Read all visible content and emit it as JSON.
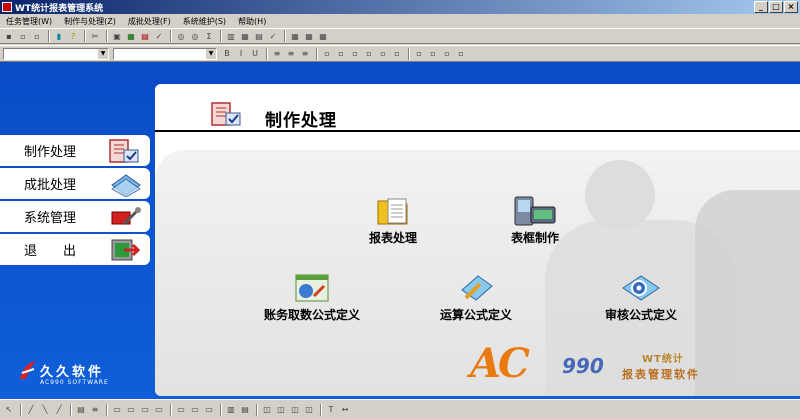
{
  "window": {
    "title": "WT统计报表管理系统"
  },
  "menu": [
    {
      "label": "任务管理(W)"
    },
    {
      "label": "制作与处理(Z)"
    },
    {
      "label": "成批处理(F)"
    },
    {
      "label": "系统维护(S)"
    },
    {
      "label": "帮助(H)"
    }
  ],
  "page": {
    "title": "制作处理"
  },
  "sidebar": [
    {
      "label": "制作处理",
      "icon": "report-edit-icon"
    },
    {
      "label": "成批处理",
      "icon": "batch-icon"
    },
    {
      "label": "系统管理",
      "icon": "system-tools-icon"
    },
    {
      "label": "退　　出",
      "icon": "exit-icon"
    }
  ],
  "features": {
    "report_process": "报表处理",
    "table_frame": "表框制作",
    "account_formula": "账务取数公式定义",
    "calc_formula": "运算公式定义",
    "audit_formula": "审核公式定义"
  },
  "logo": {
    "name": "久久软件",
    "sub": "AC990 SOFTWARE"
  },
  "brand": {
    "ac": "AC",
    "num": "990",
    "wt": "WT统计",
    "sub": "报表管理软件"
  },
  "colors": {
    "stage": "#0c52c8",
    "accent": "#e87a10"
  }
}
